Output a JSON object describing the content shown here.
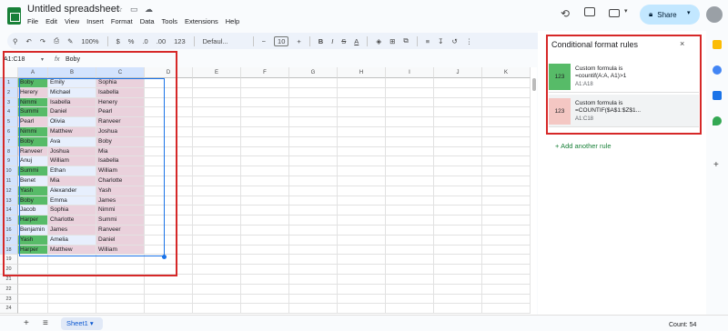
{
  "app": {
    "title": "Untitled spreadsheet",
    "menu": [
      "File",
      "Edit",
      "View",
      "Insert",
      "Format",
      "Data",
      "Tools",
      "Extensions",
      "Help"
    ],
    "share_label": "Share"
  },
  "toolbar": {
    "zoom": "100%",
    "currency": "$",
    "percent": "%",
    "decimal_dec": ".0",
    "decimal_inc": ".00",
    "number_format": "123",
    "font": "Defaul...",
    "font_size": "10",
    "bold": "B",
    "italic": "I",
    "strike": "S",
    "text_color": "A"
  },
  "formula_bar": {
    "name_box": "A1:C18",
    "fx": "fx",
    "value": "Boby"
  },
  "grid": {
    "columns": [
      "A",
      "B",
      "C",
      "D",
      "E",
      "F",
      "G",
      "H",
      "I",
      "J",
      "K"
    ],
    "rows": [
      "1",
      "2",
      "3",
      "4",
      "5",
      "6",
      "7",
      "8",
      "9",
      "10",
      "11",
      "12",
      "13",
      "14",
      "15",
      "16",
      "17",
      "18",
      "19",
      "20",
      "21",
      "22",
      "23",
      "24"
    ],
    "data": [
      [
        "Boby",
        "Emily",
        "Sophia"
      ],
      [
        "Herery",
        "Michael",
        "Isabella"
      ],
      [
        "Nimmi",
        "Isabella",
        "Henery"
      ],
      [
        "Summi",
        "Daniel",
        "Pearl"
      ],
      [
        "Pearl",
        "Olivia",
        "Ranveer"
      ],
      [
        "Nimmi",
        "Matthew",
        "Joshua"
      ],
      [
        "Boby",
        "Ava",
        "Boby"
      ],
      [
        "Ranveer",
        "Joshua",
        "Mia"
      ],
      [
        "Anuj",
        "William",
        "Isabella"
      ],
      [
        "Summi",
        "Ethan",
        "William"
      ],
      [
        "Benet",
        "Mia",
        "Charlotte"
      ],
      [
        "Yash",
        "Alexander",
        "Yash"
      ],
      [
        "Boby",
        "Emma",
        "James"
      ],
      [
        "Jacob",
        "Sophia",
        "Nimmi"
      ],
      [
        "Harper",
        "Charlotte",
        "Summi"
      ],
      [
        "Benjamin",
        "James",
        "Ranveer"
      ],
      [
        "Yash",
        "Amelia",
        "Daniel"
      ],
      [
        "Harper",
        "Matthew",
        "William"
      ]
    ],
    "fills": [
      [
        "g",
        "w",
        "p"
      ],
      [
        "p",
        "w",
        "p"
      ],
      [
        "g",
        "p",
        "p"
      ],
      [
        "g",
        "p",
        "p"
      ],
      [
        "p",
        "w",
        "p"
      ],
      [
        "g",
        "p",
        "p"
      ],
      [
        "g",
        "w",
        "p"
      ],
      [
        "p",
        "p",
        "p"
      ],
      [
        "w",
        "p",
        "p"
      ],
      [
        "g",
        "w",
        "p"
      ],
      [
        "w",
        "p",
        "p"
      ],
      [
        "g",
        "w",
        "p"
      ],
      [
        "g",
        "w",
        "p"
      ],
      [
        "w",
        "p",
        "p"
      ],
      [
        "g",
        "p",
        "p"
      ],
      [
        "w",
        "p",
        "p"
      ],
      [
        "g",
        "w",
        "p"
      ],
      [
        "g",
        "p",
        "p"
      ]
    ],
    "colors": {
      "green": "#57bb68",
      "pink": "#ead1dc",
      "white": "#ffffff",
      "selected": "#e7effd"
    }
  },
  "panel": {
    "title": "Conditional format rules",
    "close": "×",
    "rules": [
      {
        "swatch": "123",
        "line1": "Custom formula is",
        "line2": "=countif(A:A, A1)>1",
        "range": "A1:A18",
        "color": "#57bb68"
      },
      {
        "swatch": "123",
        "line1": "Custom formula is",
        "line2": "=COUNTIF($A$1:$Z$1...",
        "range": "A1:C18",
        "color": "#f4c7c3"
      }
    ],
    "add_rule": "Add another rule"
  },
  "bottom": {
    "add": "+",
    "all_sheets": "≡",
    "sheet": "Sheet1",
    "count": "Count: 54"
  }
}
